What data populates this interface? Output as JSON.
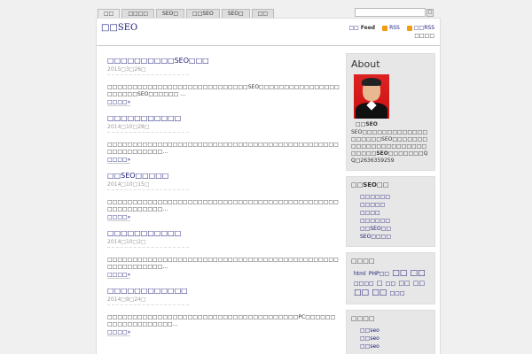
{
  "nav": {
    "tabs": [
      {
        "label": "□□"
      },
      {
        "label": "□□□□"
      },
      {
        "label": "SEO□"
      },
      {
        "label": "□□SEO"
      },
      {
        "label": "SEO□"
      },
      {
        "label": "□□"
      }
    ],
    "search_value": "",
    "search_button": "□"
  },
  "header": {
    "site_title": "□□SEO",
    "feed_label_prefix": "□□",
    "feed_label_bold": "Feed",
    "rss_label": "RSS",
    "rss2_label": "□□RSS",
    "subscribe_label": "□□□□"
  },
  "posts": [
    {
      "title": "□□□□□□□□□□SEO□□□",
      "date": "2015□3□26□",
      "excerpt": "□□□□□□□□□□□□□□□□□□□□□□□□□□□□SEO□□□□□□□□□□□□□□□□□□□□□□SEO□□□□□□ …",
      "more": "□□□□»"
    },
    {
      "title": "□□□□□□□□□□□",
      "date": "2014□10□28□",
      "excerpt": "□□□□□□□□□□□□□□□□□□□□□□□□□□□□□□□□□□□□□□□□□□□□□□□□□□□□□□□□□…",
      "more": "□□□□»"
    },
    {
      "title": "□□SEO□□□□□",
      "date": "2014□10□15□",
      "excerpt": "□□□□□□□□□□□□□□□□□□□□□□□□□□□□□□□□□□□□□□□□□□□□□□□□□□□□□□□□□…",
      "more": "□□□□»"
    },
    {
      "title": "□□□□□□□□□□□",
      "date": "2014□10□2□",
      "excerpt": "□□□□□□□□□□□□□□□□□□□□□□□□□□□□□□□□□□□□□□□□□□□□□□□□□□□□□□□□□…",
      "more": "□□□□»"
    },
    {
      "title": "□□□□□□□□□□□□",
      "date": "2014□9□24□",
      "excerpt": "□□□□□□□□□□□□□□□□□□□□□□□□□□□□□□□□□□□□□□PC□□□□□□□□□□□□□□□□□□□…",
      "more": "□□□□»"
    }
  ],
  "sidebar": {
    "about": {
      "title": "About",
      "name": "□□SEO",
      "text_1": "SEO□□□□□□□□□□□□□□□□□□□SEO□□□□□□□□□□□□□□□□□□□□□□□□□□□",
      "text_bold": "SEO",
      "text_2": "□□□□□□□QQ□2636359259"
    },
    "links": {
      "title": "□□SEO□□",
      "items": [
        "□□□□□□",
        "□□□□□",
        "□□□□",
        "□□□□□□",
        "□□SEO□□",
        "SEO□□□□"
      ]
    },
    "tags": {
      "title": "□□□□",
      "items": [
        {
          "label": "html",
          "size": "s"
        },
        {
          "label": "PHP□□",
          "size": "s"
        },
        {
          "label": "□□",
          "size": "l"
        },
        {
          "label": "□□",
          "size": "l"
        },
        {
          "label": "□□□□",
          "size": "s"
        },
        {
          "label": "□",
          "size": "m"
        },
        {
          "label": "□□",
          "size": "s"
        },
        {
          "label": "□□",
          "size": "m"
        },
        {
          "label": "□□",
          "size": "m"
        },
        {
          "label": "□□",
          "size": "l"
        },
        {
          "label": "□□",
          "size": "l"
        },
        {
          "label": "□□□",
          "size": "s"
        }
      ]
    },
    "recent": {
      "title": "□□□□",
      "items": [
        "□□seo",
        "□□seo",
        "□□seo"
      ]
    }
  }
}
